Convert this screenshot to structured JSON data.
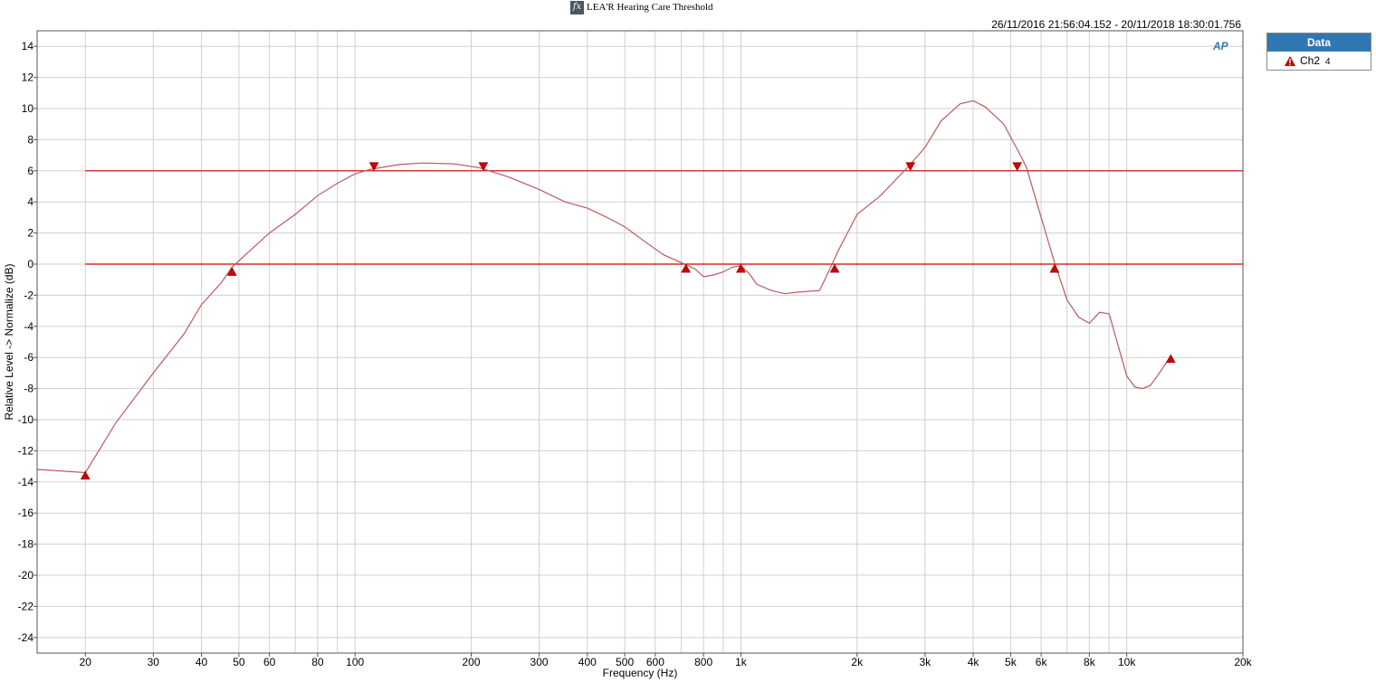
{
  "window": {
    "title": "LEA'R Hearing Care Threshold",
    "timestamp": "26/11/2016 21:56:04.152 - 20/11/2018 18:30:01.756",
    "logo_text": "AP"
  },
  "legend": {
    "header": "Data",
    "items": [
      {
        "label": "Ch2",
        "index": "4",
        "color": "#c00000",
        "icon": "warning-triangle-icon"
      }
    ]
  },
  "chart_data": {
    "type": "line",
    "title": "",
    "xlabel": "Frequency (Hz)",
    "ylabel": "Relative Level -> Normalize (dB)",
    "xscale": "log",
    "xlim": [
      15,
      20000
    ],
    "ylim": [
      -25,
      15
    ],
    "grid": true,
    "legend_position": "right",
    "xticks": [
      {
        "value": 20,
        "label": "20"
      },
      {
        "value": 30,
        "label": "30"
      },
      {
        "value": 40,
        "label": "40"
      },
      {
        "value": 50,
        "label": "50"
      },
      {
        "value": 60,
        "label": "60"
      },
      {
        "value": 80,
        "label": "80"
      },
      {
        "value": 100,
        "label": "100"
      },
      {
        "value": 200,
        "label": "200"
      },
      {
        "value": 300,
        "label": "300"
      },
      {
        "value": 400,
        "label": "400"
      },
      {
        "value": 500,
        "label": "500"
      },
      {
        "value": 600,
        "label": "600"
      },
      {
        "value": 800,
        "label": "800"
      },
      {
        "value": 1000,
        "label": "1k"
      },
      {
        "value": 2000,
        "label": "2k"
      },
      {
        "value": 3000,
        "label": "3k"
      },
      {
        "value": 4000,
        "label": "4k"
      },
      {
        "value": 5000,
        "label": "5k"
      },
      {
        "value": 6000,
        "label": "6k"
      },
      {
        "value": 8000,
        "label": "8k"
      },
      {
        "value": 10000,
        "label": "10k"
      },
      {
        "value": 20000,
        "label": "20k"
      }
    ],
    "minor_xgrid": [
      15,
      70,
      90,
      700,
      900,
      7000,
      9000
    ],
    "yticks": [
      {
        "value": 14,
        "label": "14"
      },
      {
        "value": 12,
        "label": "12"
      },
      {
        "value": 10,
        "label": "10"
      },
      {
        "value": 8,
        "label": "8"
      },
      {
        "value": 6,
        "label": "6"
      },
      {
        "value": 4,
        "label": "4"
      },
      {
        "value": 2,
        "label": "2"
      },
      {
        "value": 0,
        "label": "0"
      },
      {
        "value": -2,
        "label": "-2"
      },
      {
        "value": -4,
        "label": "-4"
      },
      {
        "value": -6,
        "label": "-6"
      },
      {
        "value": -8,
        "label": "-8"
      },
      {
        "value": -10,
        "label": "-10"
      },
      {
        "value": -12,
        "label": "-12"
      },
      {
        "value": -14,
        "label": "-14"
      },
      {
        "value": -16,
        "label": "-16"
      },
      {
        "value": -18,
        "label": "-18"
      },
      {
        "value": -20,
        "label": "-20"
      },
      {
        "value": -22,
        "label": "-22"
      },
      {
        "value": -24,
        "label": "-24"
      }
    ],
    "limit_lines": [
      {
        "y": 6,
        "x_range": [
          20,
          20000
        ],
        "color": "#cc0000"
      },
      {
        "y": 0,
        "x_range": [
          20,
          20000
        ],
        "color": "#cc0000"
      }
    ],
    "series": [
      {
        "name": "Ch2",
        "color": "#b85c5c",
        "x": [
          15,
          20,
          24,
          30,
          36,
          40,
          45,
          48,
          52,
          60,
          70,
          80,
          90,
          100,
          110,
          130,
          150,
          180,
          210,
          250,
          300,
          350,
          400,
          450,
          500,
          560,
          630,
          700,
          760,
          800,
          850,
          900,
          950,
          1000,
          1050,
          1100,
          1200,
          1300,
          1400,
          1600,
          1700,
          1800,
          2000,
          2300,
          2700,
          3000,
          3300,
          3700,
          4000,
          4300,
          4800,
          5300,
          5500,
          6000,
          6500,
          7000,
          7500,
          8000,
          8500,
          9000,
          10000,
          10500,
          11000,
          11500,
          12000,
          13000
        ],
        "y": [
          -13.2,
          -13.4,
          -10.2,
          -7,
          -4.5,
          -2.6,
          -1.2,
          -0.2,
          0.6,
          2,
          3.2,
          4.4,
          5.2,
          5.8,
          6.1,
          6.4,
          6.5,
          6.45,
          6.2,
          5.6,
          4.8,
          4,
          3.6,
          3,
          2.4,
          1.5,
          0.6,
          0.1,
          -0.3,
          -0.8,
          -0.7,
          -0.5,
          -0.2,
          -0.1,
          -0.6,
          -1.3,
          -1.7,
          -1.9,
          -1.8,
          -1.7,
          -0.3,
          1,
          3.2,
          4.4,
          6.2,
          7.5,
          9.2,
          10.3,
          10.5,
          10.1,
          9,
          7,
          6.2,
          3,
          0.1,
          -2.3,
          -3.4,
          -3.8,
          -3.1,
          -3.2,
          -7.2,
          -7.9,
          -8,
          -7.8,
          -7.2,
          -5.9
        ]
      }
    ],
    "markers": [
      {
        "x": 20,
        "y": -13.6,
        "dir": "up"
      },
      {
        "x": 48,
        "y": -0.5,
        "dir": "up"
      },
      {
        "x": 112,
        "y": 6.3,
        "dir": "down"
      },
      {
        "x": 215,
        "y": 6.3,
        "dir": "down"
      },
      {
        "x": 720,
        "y": -0.3,
        "dir": "up"
      },
      {
        "x": 1000,
        "y": -0.3,
        "dir": "up"
      },
      {
        "x": 1750,
        "y": -0.3,
        "dir": "up"
      },
      {
        "x": 2750,
        "y": 6.3,
        "dir": "down"
      },
      {
        "x": 5200,
        "y": 6.3,
        "dir": "down"
      },
      {
        "x": 6500,
        "y": -0.3,
        "dir": "up"
      },
      {
        "x": 13000,
        "y": -6.1,
        "dir": "up"
      }
    ]
  }
}
